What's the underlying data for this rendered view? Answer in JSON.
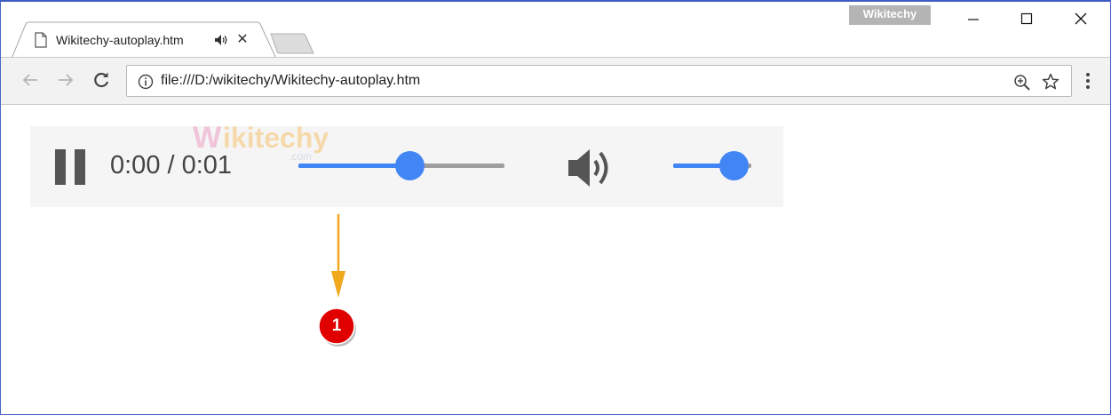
{
  "window": {
    "brand_badge": "Wikitechy",
    "controls": {
      "minimize_icon": "minimize-icon",
      "maximize_icon": "maximize-icon",
      "close_icon": "close-icon"
    }
  },
  "tab": {
    "title": "Wikitechy-autoplay.htm",
    "page_icon": "document-icon",
    "audio_icon": "speaker-playing-icon",
    "close_glyph": "✕"
  },
  "toolbar": {
    "back_icon": "arrow-left-icon",
    "forward_icon": "arrow-right-icon",
    "reload_icon": "reload-icon",
    "address": {
      "security_icon": "info-icon",
      "url": "file:///D:/wikitechy/Wikitechy-autoplay.htm",
      "zoom_icon": "zoom-in-icon",
      "bookmark_icon": "star-icon"
    },
    "menu_icon": "vertical-dots-icon"
  },
  "content": {
    "watermark": {
      "text": "Wikitechy",
      "subtext": ".com"
    },
    "audio_player": {
      "play_state": "playing",
      "pause_icon": "pause-icon",
      "time_text": "0:00 / 0:01",
      "seek_fraction": 0.54,
      "volume_icon": "volume-high-icon",
      "volume_fraction": 0.77
    },
    "annotation": {
      "badge_label": "1"
    }
  },
  "colors": {
    "accent": "#4285f4",
    "track": "#9e9e9e",
    "arrow": "#f0a81c",
    "badge": "#e00000",
    "player_bg": "#f5f5f5"
  }
}
